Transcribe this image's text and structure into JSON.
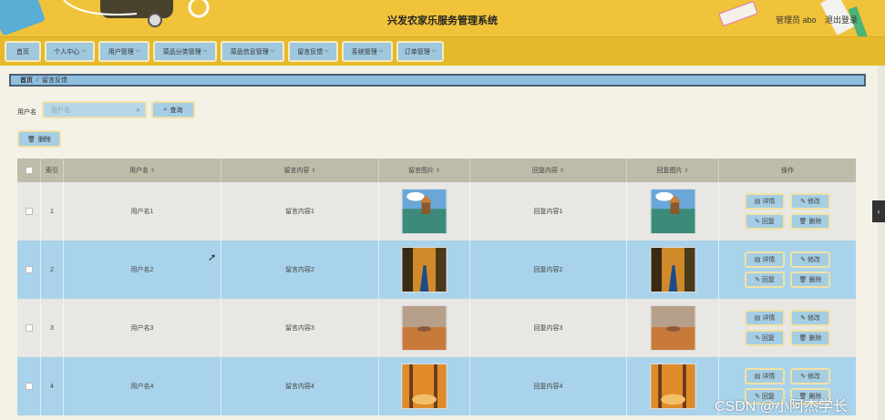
{
  "header": {
    "title": "兴发农家乐服务管理系统",
    "admin_label": "管理员 abo",
    "logout_label": "退出登录"
  },
  "nav": {
    "items": [
      {
        "label": "首页",
        "has_dropdown": false
      },
      {
        "label": "个人中心",
        "has_dropdown": true
      },
      {
        "label": "用户管理",
        "has_dropdown": true
      },
      {
        "label": "菜品分类管理",
        "has_dropdown": true
      },
      {
        "label": "菜品信息管理",
        "has_dropdown": true
      },
      {
        "label": "留言反馈",
        "has_dropdown": true
      },
      {
        "label": "系统管理",
        "has_dropdown": true
      },
      {
        "label": "订单管理",
        "has_dropdown": true
      }
    ]
  },
  "breadcrumb": {
    "home": "首页",
    "separator": "/",
    "current": "留言反馈"
  },
  "search": {
    "label": "用户名",
    "placeholder": "用户名",
    "search_button": "查询"
  },
  "toolbar": {
    "delete_label": "删除"
  },
  "table": {
    "columns": [
      {
        "label": "",
        "sortable": false
      },
      {
        "label": "索引",
        "sortable": false
      },
      {
        "label": "用户名",
        "sortable": true
      },
      {
        "label": "留言内容",
        "sortable": true
      },
      {
        "label": "留言图片",
        "sortable": true
      },
      {
        "label": "回复内容",
        "sortable": true
      },
      {
        "label": "回复图片",
        "sortable": true
      },
      {
        "label": "操作",
        "sortable": false
      }
    ],
    "sort_icon": "⇕",
    "rows": [
      {
        "index": "1",
        "username": "用户名1",
        "message": "留言内容1",
        "reply": "回复内容1",
        "image": "lake-scene"
      },
      {
        "index": "2",
        "username": "用户名2",
        "message": "留言内容2",
        "reply": "回复内容2",
        "image": "road-scene"
      },
      {
        "index": "3",
        "username": "用户名3",
        "message": "留言内容3",
        "reply": "回复内容3",
        "image": "desert-scene"
      },
      {
        "index": "4",
        "username": "用户名4",
        "message": "留言内容4",
        "reply": "回复内容4",
        "image": "autumn-forest"
      }
    ],
    "actions": {
      "detail": "详情",
      "edit": "修改",
      "reply": "回复",
      "delete": "删除"
    }
  },
  "watermark": "CSDN @小阿杰学长",
  "colors": {
    "header_bg": "#f0c33a",
    "button_bg": "#a5cde3",
    "row_highlight": "#a9d3ea",
    "table_header": "#bebba9"
  }
}
